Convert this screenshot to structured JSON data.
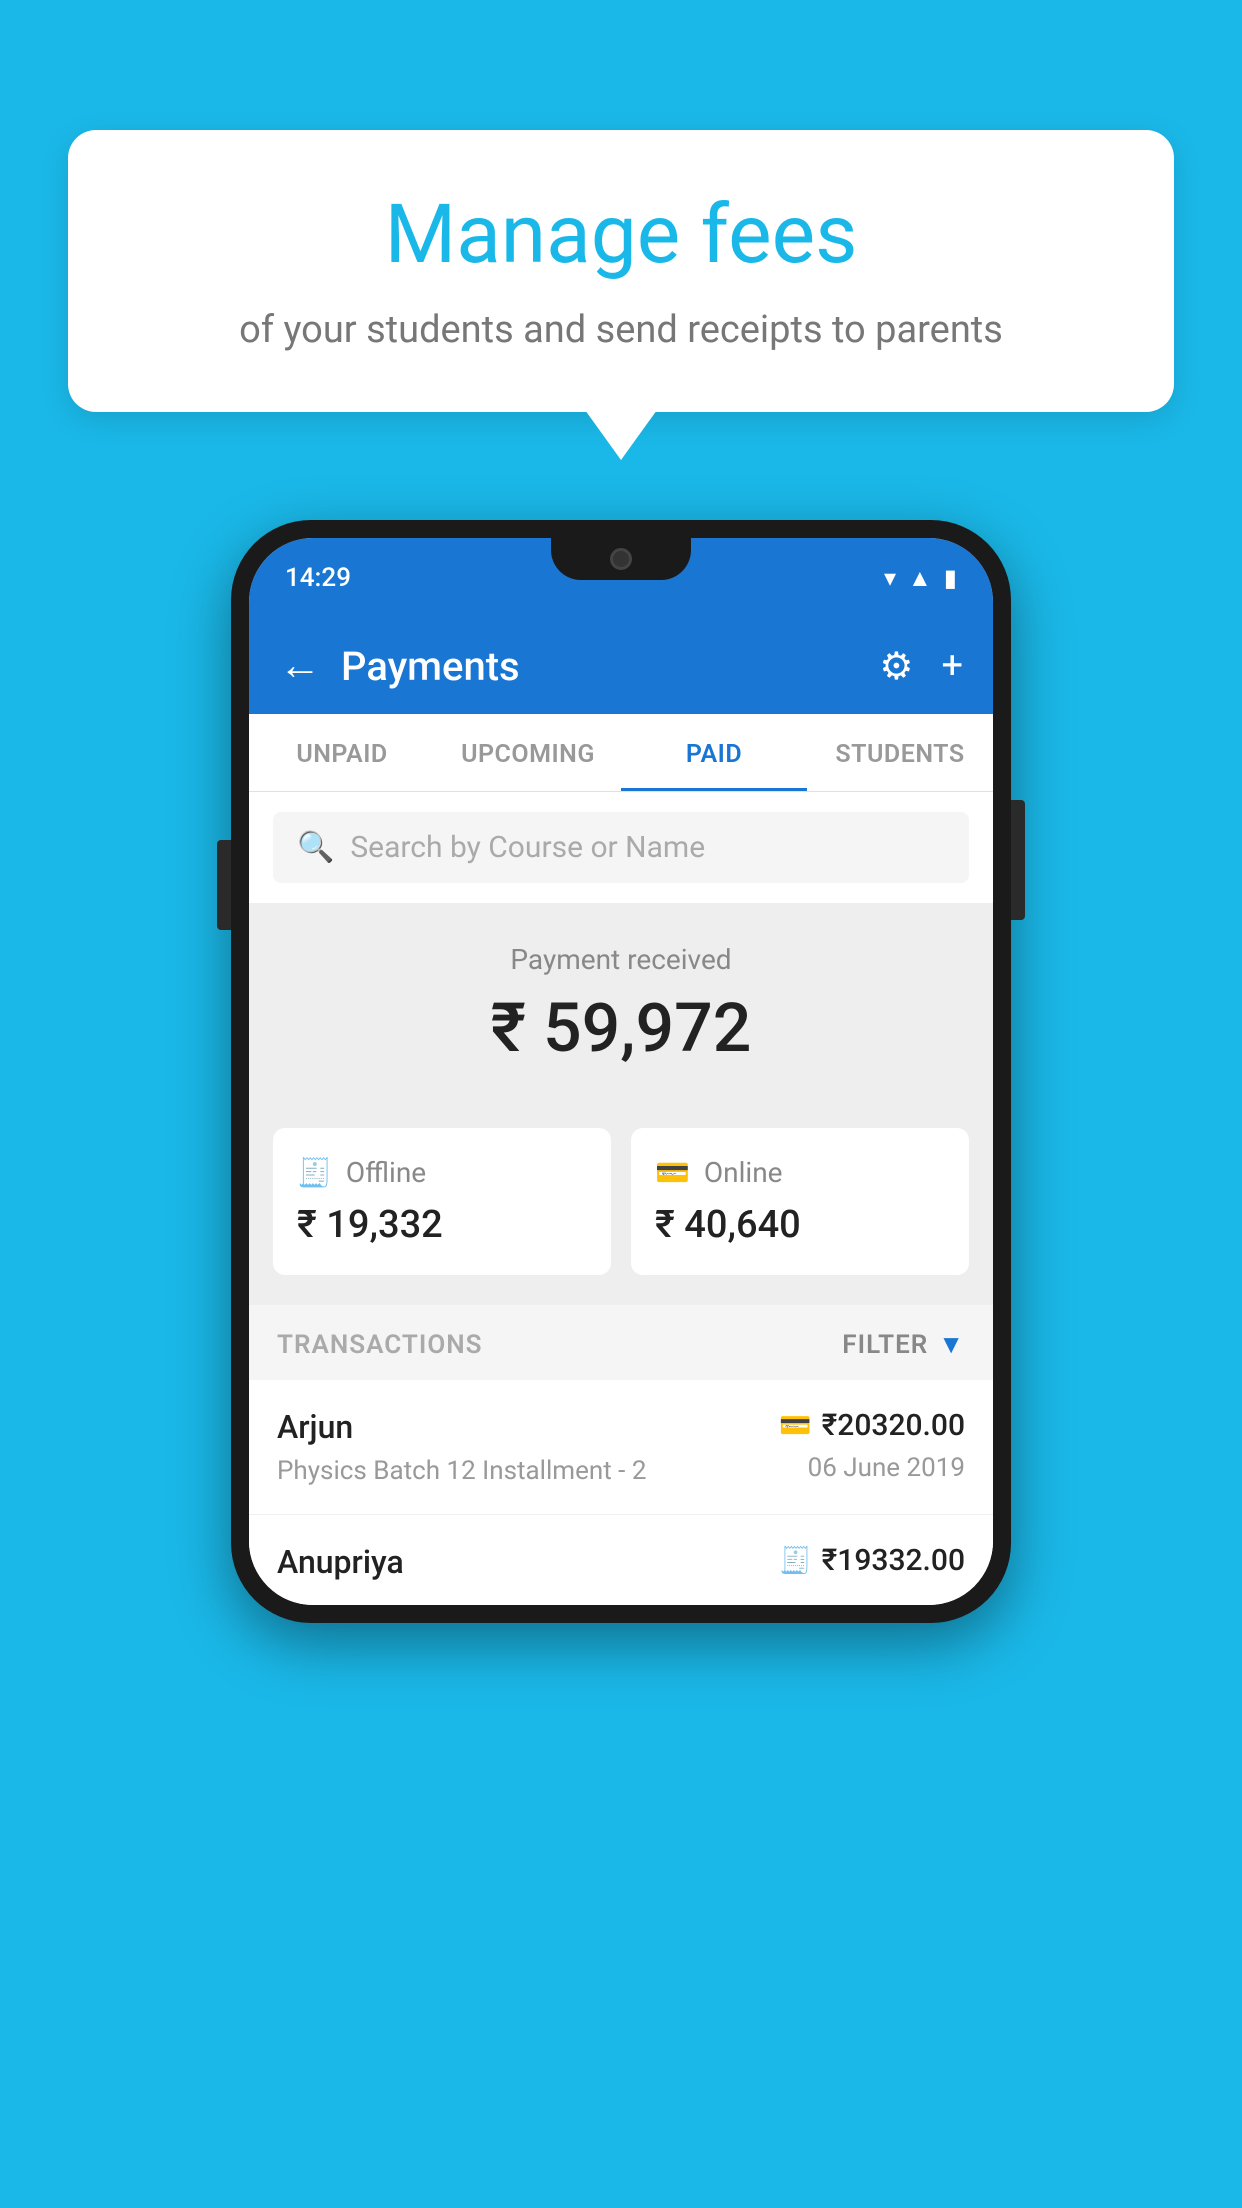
{
  "background_color": "#1ab8e8",
  "speech_bubble": {
    "title": "Manage fees",
    "subtitle": "of your students and send receipts to parents"
  },
  "status_bar": {
    "time": "14:29",
    "icons": [
      "wifi",
      "signal",
      "battery"
    ]
  },
  "header": {
    "title": "Payments",
    "back_label": "←",
    "settings_label": "⚙",
    "add_label": "+"
  },
  "tabs": [
    {
      "label": "UNPAID",
      "active": false
    },
    {
      "label": "UPCOMING",
      "active": false
    },
    {
      "label": "PAID",
      "active": true
    },
    {
      "label": "STUDENTS",
      "active": false
    }
  ],
  "search": {
    "placeholder": "Search by Course or Name"
  },
  "payment_summary": {
    "label": "Payment received",
    "amount": "₹ 59,972",
    "offline_label": "Offline",
    "offline_amount": "₹ 19,332",
    "online_label": "Online",
    "online_amount": "₹ 40,640"
  },
  "transactions": {
    "section_label": "TRANSACTIONS",
    "filter_label": "FILTER",
    "rows": [
      {
        "name": "Arjun",
        "detail": "Physics Batch 12 Installment - 2",
        "amount": "₹20320.00",
        "date": "06 June 2019",
        "payment_type": "card"
      },
      {
        "name": "Anupriya",
        "detail": "",
        "amount": "₹19332.00",
        "date": "",
        "payment_type": "offline"
      }
    ]
  }
}
